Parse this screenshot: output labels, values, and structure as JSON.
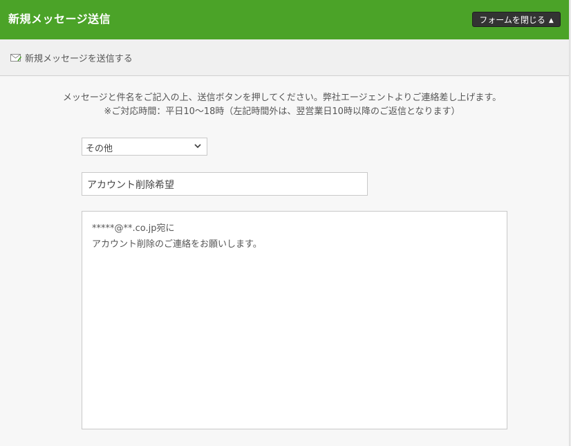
{
  "header": {
    "title": "新規メッセージ送信",
    "close_button_label": "フォームを閉じる",
    "close_button_arrow": "▲"
  },
  "subbar": {
    "icon": "envelope-icon",
    "label": "新規メッセージを送信する"
  },
  "instructions": {
    "line1": "メッセージと件名をご記入の上、送信ボタンを押してください。弊社エージェントよりご連絡差し上げます。",
    "line2": "※ご対応時間：平日10〜18時（左記時間外は、翌営業日10時以降のご返信となります）"
  },
  "form": {
    "category_value": "その他",
    "subject_value": "アカウント削除希望",
    "body_lines": [
      "*****@**.co.jp宛に",
      "アカウント削除のご連絡をお願いします。"
    ]
  },
  "colors": {
    "header_bg": "#4ba328",
    "button_bg": "#333333"
  }
}
